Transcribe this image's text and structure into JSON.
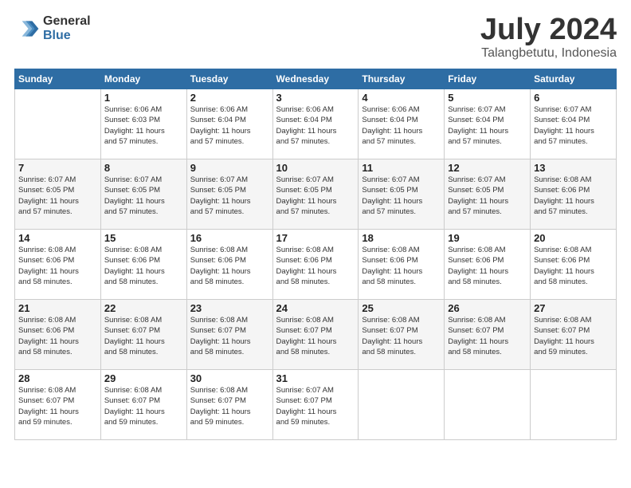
{
  "logo": {
    "general": "General",
    "blue": "Blue"
  },
  "title": {
    "month": "July 2024",
    "location": "Talangbetutu, Indonesia"
  },
  "days_header": [
    "Sunday",
    "Monday",
    "Tuesday",
    "Wednesday",
    "Thursday",
    "Friday",
    "Saturday"
  ],
  "weeks": [
    [
      {
        "day": "",
        "info": ""
      },
      {
        "day": "1",
        "info": "Sunrise: 6:06 AM\nSunset: 6:03 PM\nDaylight: 11 hours\nand 57 minutes."
      },
      {
        "day": "2",
        "info": "Sunrise: 6:06 AM\nSunset: 6:04 PM\nDaylight: 11 hours\nand 57 minutes."
      },
      {
        "day": "3",
        "info": "Sunrise: 6:06 AM\nSunset: 6:04 PM\nDaylight: 11 hours\nand 57 minutes."
      },
      {
        "day": "4",
        "info": "Sunrise: 6:06 AM\nSunset: 6:04 PM\nDaylight: 11 hours\nand 57 minutes."
      },
      {
        "day": "5",
        "info": "Sunrise: 6:07 AM\nSunset: 6:04 PM\nDaylight: 11 hours\nand 57 minutes."
      },
      {
        "day": "6",
        "info": "Sunrise: 6:07 AM\nSunset: 6:04 PM\nDaylight: 11 hours\nand 57 minutes."
      }
    ],
    [
      {
        "day": "7",
        "info": "Sunrise: 6:07 AM\nSunset: 6:05 PM\nDaylight: 11 hours\nand 57 minutes."
      },
      {
        "day": "8",
        "info": "Sunrise: 6:07 AM\nSunset: 6:05 PM\nDaylight: 11 hours\nand 57 minutes."
      },
      {
        "day": "9",
        "info": "Sunrise: 6:07 AM\nSunset: 6:05 PM\nDaylight: 11 hours\nand 57 minutes."
      },
      {
        "day": "10",
        "info": "Sunrise: 6:07 AM\nSunset: 6:05 PM\nDaylight: 11 hours\nand 57 minutes."
      },
      {
        "day": "11",
        "info": "Sunrise: 6:07 AM\nSunset: 6:05 PM\nDaylight: 11 hours\nand 57 minutes."
      },
      {
        "day": "12",
        "info": "Sunrise: 6:07 AM\nSunset: 6:05 PM\nDaylight: 11 hours\nand 57 minutes."
      },
      {
        "day": "13",
        "info": "Sunrise: 6:08 AM\nSunset: 6:06 PM\nDaylight: 11 hours\nand 57 minutes."
      }
    ],
    [
      {
        "day": "14",
        "info": "Sunrise: 6:08 AM\nSunset: 6:06 PM\nDaylight: 11 hours\nand 58 minutes."
      },
      {
        "day": "15",
        "info": "Sunrise: 6:08 AM\nSunset: 6:06 PM\nDaylight: 11 hours\nand 58 minutes."
      },
      {
        "day": "16",
        "info": "Sunrise: 6:08 AM\nSunset: 6:06 PM\nDaylight: 11 hours\nand 58 minutes."
      },
      {
        "day": "17",
        "info": "Sunrise: 6:08 AM\nSunset: 6:06 PM\nDaylight: 11 hours\nand 58 minutes."
      },
      {
        "day": "18",
        "info": "Sunrise: 6:08 AM\nSunset: 6:06 PM\nDaylight: 11 hours\nand 58 minutes."
      },
      {
        "day": "19",
        "info": "Sunrise: 6:08 AM\nSunset: 6:06 PM\nDaylight: 11 hours\nand 58 minutes."
      },
      {
        "day": "20",
        "info": "Sunrise: 6:08 AM\nSunset: 6:06 PM\nDaylight: 11 hours\nand 58 minutes."
      }
    ],
    [
      {
        "day": "21",
        "info": "Sunrise: 6:08 AM\nSunset: 6:06 PM\nDaylight: 11 hours\nand 58 minutes."
      },
      {
        "day": "22",
        "info": "Sunrise: 6:08 AM\nSunset: 6:07 PM\nDaylight: 11 hours\nand 58 minutes."
      },
      {
        "day": "23",
        "info": "Sunrise: 6:08 AM\nSunset: 6:07 PM\nDaylight: 11 hours\nand 58 minutes."
      },
      {
        "day": "24",
        "info": "Sunrise: 6:08 AM\nSunset: 6:07 PM\nDaylight: 11 hours\nand 58 minutes."
      },
      {
        "day": "25",
        "info": "Sunrise: 6:08 AM\nSunset: 6:07 PM\nDaylight: 11 hours\nand 58 minutes."
      },
      {
        "day": "26",
        "info": "Sunrise: 6:08 AM\nSunset: 6:07 PM\nDaylight: 11 hours\nand 58 minutes."
      },
      {
        "day": "27",
        "info": "Sunrise: 6:08 AM\nSunset: 6:07 PM\nDaylight: 11 hours\nand 59 minutes."
      }
    ],
    [
      {
        "day": "28",
        "info": "Sunrise: 6:08 AM\nSunset: 6:07 PM\nDaylight: 11 hours\nand 59 minutes."
      },
      {
        "day": "29",
        "info": "Sunrise: 6:08 AM\nSunset: 6:07 PM\nDaylight: 11 hours\nand 59 minutes."
      },
      {
        "day": "30",
        "info": "Sunrise: 6:08 AM\nSunset: 6:07 PM\nDaylight: 11 hours\nand 59 minutes."
      },
      {
        "day": "31",
        "info": "Sunrise: 6:07 AM\nSunset: 6:07 PM\nDaylight: 11 hours\nand 59 minutes."
      },
      {
        "day": "",
        "info": ""
      },
      {
        "day": "",
        "info": ""
      },
      {
        "day": "",
        "info": ""
      }
    ]
  ]
}
